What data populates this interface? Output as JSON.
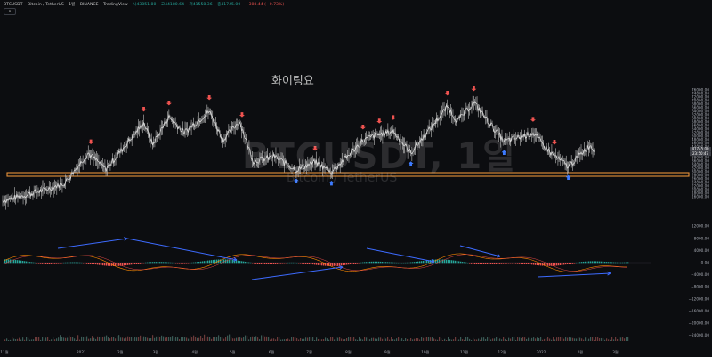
{
  "header": {
    "symbol": "BTCUSDT",
    "name": "Bitcoin / TetherUS",
    "interval": "1일",
    "exchange": "BINANCE",
    "source": "TradingView",
    "open": "시43851.80",
    "high": "고44180.64",
    "low": "저41558.36",
    "close": "종41745.00",
    "change": "−308.44 (−0.73%)",
    "toggle_label": "∧"
  },
  "watermark": {
    "main": "BTCUSDT, 1일",
    "sub": "Bitcoin / TetherUS"
  },
  "annotation_text": "화이팅요",
  "colors": {
    "background": "#0c0d10",
    "price_line": "#d6d6d6",
    "support_zone": "#e8923a",
    "sell_arrow": "#ef5350",
    "buy_arrow": "#3d7bff",
    "divergence_line": "#3d6bff",
    "macd_line": "#ff8a00",
    "signal_line": "#e04848",
    "hist_positive": "#26a69a",
    "hist_negative": "#ef5350"
  },
  "chart_data": {
    "type": "line",
    "title": "BTCUSDT, 1일",
    "xlabel": "",
    "ylabel": "",
    "x_labels": [
      "11월",
      "2021",
      "2월",
      "3월",
      "4월",
      "5월",
      "6월",
      "7월",
      "8월",
      "9월",
      "10월",
      "11월",
      "12월",
      "2022",
      "2월",
      "3월"
    ],
    "y_tick_labels": [
      "76000.00",
      "74000.00",
      "72000.00",
      "70000.00",
      "68000.00",
      "66000.00",
      "64000.00",
      "62000.00",
      "60000.00",
      "58000.00",
      "56000.00",
      "54000.00",
      "52000.00",
      "50000.00",
      "48000.00",
      "46000.00",
      "44000.00",
      "42000.00",
      "40000.00",
      "38000.00",
      "36000.00",
      "34000.00",
      "32000.00",
      "30000.00",
      "28000.00",
      "26000.00",
      "24000.00",
      "22000.00",
      "20000.00",
      "18000.00",
      "16000.00",
      "12000.00",
      "8000.00",
      "4000.00",
      "0.00",
      "−4000.00",
      "−8000.00",
      "−12000.00",
      "−16000.00",
      "−20000.00",
      "−24000.00"
    ],
    "price_labels": [
      "41745.00",
      "23:50:47"
    ],
    "ylim": [
      16000,
      77000
    ],
    "series": [
      {
        "values": [
          {
            "x": "2020-11-01",
            "y": 13800
          },
          {
            "x": "2020-12-01",
            "y": 19200
          },
          {
            "x": "2020-12-20",
            "y": 23500
          },
          {
            "x": "2021-01-08",
            "y": 40500
          },
          {
            "x": "2021-01-22",
            "y": 31500
          },
          {
            "x": "2021-02-21",
            "y": 57500
          },
          {
            "x": "2021-02-28",
            "y": 45500
          },
          {
            "x": "2021-03-13",
            "y": 61000
          },
          {
            "x": "2021-03-25",
            "y": 52000
          },
          {
            "x": "2021-04-14",
            "y": 64000
          },
          {
            "x": "2021-04-25",
            "y": 48000
          },
          {
            "x": "2021-05-08",
            "y": 58500
          },
          {
            "x": "2021-05-19",
            "y": 36000
          },
          {
            "x": "2021-06-05",
            "y": 38500
          },
          {
            "x": "2021-06-22",
            "y": 31000
          },
          {
            "x": "2021-07-07",
            "y": 35500
          },
          {
            "x": "2021-07-20",
            "y": 29800
          },
          {
            "x": "2021-08-14",
            "y": 47500
          },
          {
            "x": "2021-08-22",
            "y": 50000
          },
          {
            "x": "2021-09-07",
            "y": 52800
          },
          {
            "x": "2021-09-21",
            "y": 40600
          },
          {
            "x": "2021-10-20",
            "y": 66500
          },
          {
            "x": "2021-10-28",
            "y": 58500
          },
          {
            "x": "2021-11-10",
            "y": 69000
          },
          {
            "x": "2021-12-04",
            "y": 47000
          },
          {
            "x": "2021-12-27",
            "y": 51800
          },
          {
            "x": "2022-01-10",
            "y": 40600
          },
          {
            "x": "2022-01-24",
            "y": 33000
          },
          {
            "x": "2022-02-10",
            "y": 45000
          },
          {
            "x": "2022-02-14",
            "y": 41745
          }
        ]
      }
    ],
    "support_zone": [
      27500,
      29500
    ],
    "sell_signals": [
      "2021-01-10",
      "2021-02-21",
      "2021-03-13",
      "2021-04-14",
      "2021-05-10",
      "2021-07-07",
      "2021-08-14",
      "2021-08-27",
      "2021-09-07",
      "2021-10-20",
      "2021-11-10",
      "2021-12-27",
      "2022-01-13"
    ],
    "buy_signals": [
      "2021-06-22",
      "2021-07-20",
      "2021-09-21",
      "2021-12-04",
      "2022-01-24"
    ]
  }
}
